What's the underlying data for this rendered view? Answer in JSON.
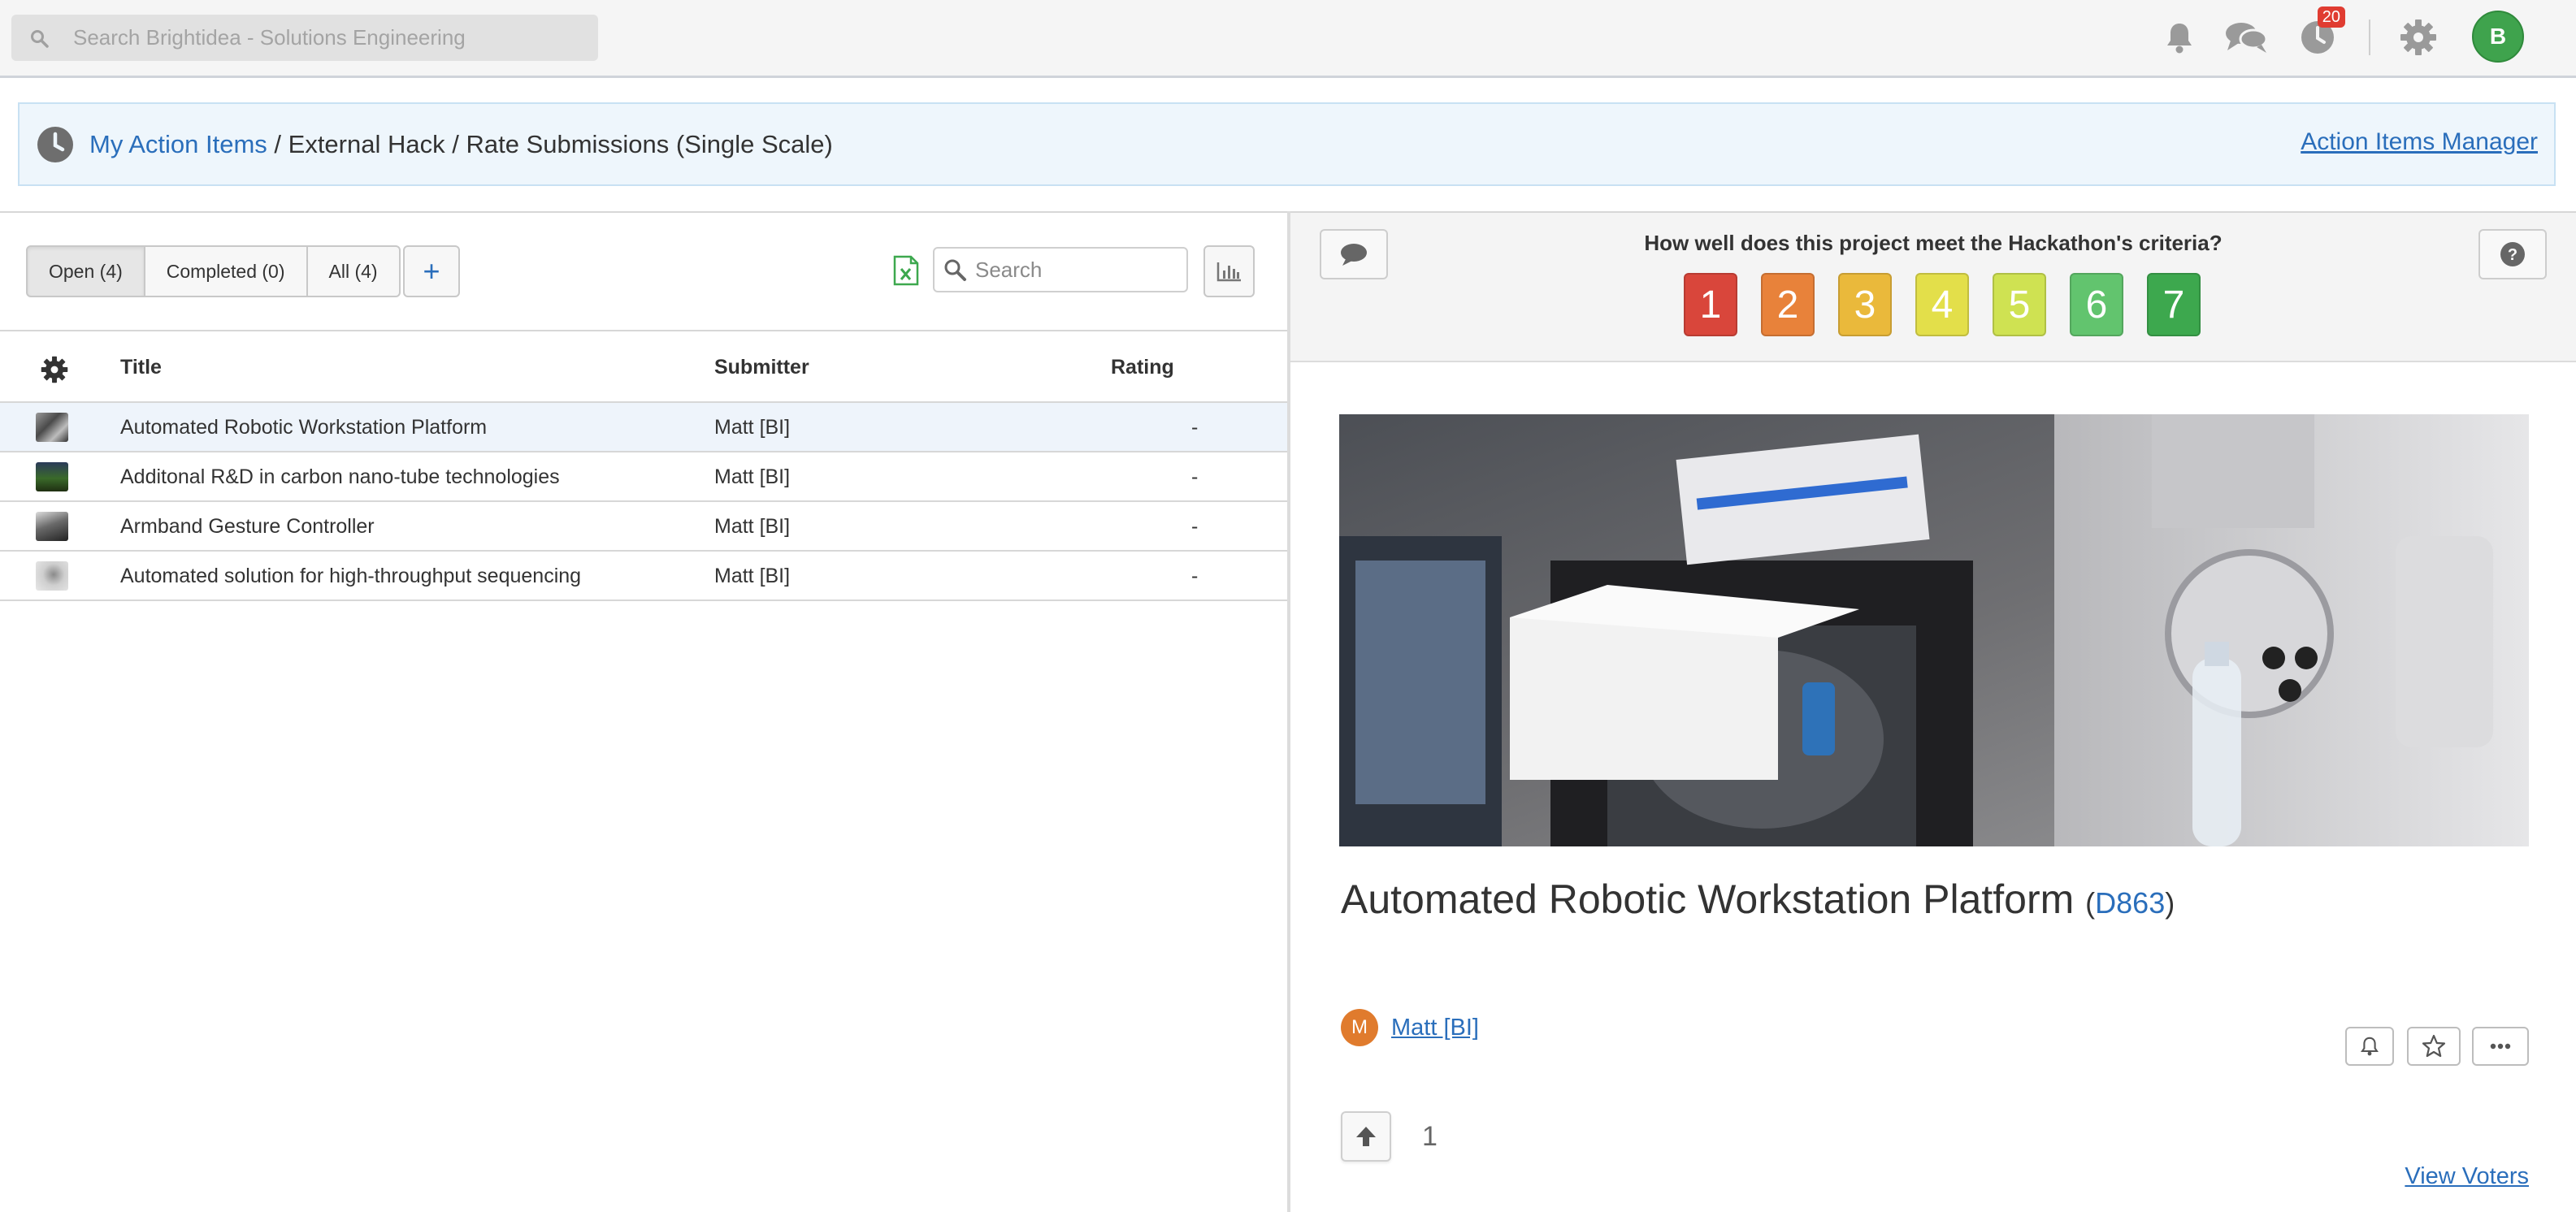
{
  "topbar": {
    "search_placeholder": "Search Brightidea - Solutions Engineering",
    "notifications_badge": "20",
    "user_initial": "B"
  },
  "breadcrumb": {
    "root": "My Action Items",
    "separator": " / ",
    "program": "External Hack",
    "step": "Rate Submissions (Single Scale)",
    "manager_link": "Action Items Manager"
  },
  "list": {
    "tabs": [
      {
        "label": "Open (4)"
      },
      {
        "label": "Completed (0)"
      },
      {
        "label": "All (4)"
      }
    ],
    "add_label": "+",
    "search_placeholder": "Search",
    "columns": {
      "title": "Title",
      "submitter": "Submitter",
      "rating": "Rating"
    },
    "rows": [
      {
        "title": "Automated Robotic Workstation Platform",
        "submitter": "Matt [BI]",
        "rating": "-"
      },
      {
        "title": "Additonal R&D in carbon nano-tube technologies",
        "submitter": "Matt [BI]",
        "rating": "-"
      },
      {
        "title": "Armband Gesture Controller",
        "submitter": "Matt [BI]",
        "rating": "-"
      },
      {
        "title": "Automated solution for high-throughput sequencing",
        "submitter": "Matt [BI]",
        "rating": "-"
      }
    ]
  },
  "rating": {
    "question": "How well does this project meet the Hackathon's criteria?",
    "scale": [
      {
        "label": "1",
        "color": "#d9463b"
      },
      {
        "label": "2",
        "color": "#e8823a"
      },
      {
        "label": "3",
        "color": "#eab93b"
      },
      {
        "label": "4",
        "color": "#e3df4a"
      },
      {
        "label": "5",
        "color": "#cfe252"
      },
      {
        "label": "6",
        "color": "#62c46e"
      },
      {
        "label": "7",
        "color": "#3da84e"
      }
    ]
  },
  "idea": {
    "title": "Automated Robotic Workstation Platform",
    "paren_open": "(",
    "id": "D863",
    "paren_close": ")",
    "submitter_initial": "M",
    "submitter": "Matt [BI]",
    "votes": "1",
    "view_voters": "View Voters"
  },
  "colors": {
    "link": "#2a6ebb",
    "breadcrumb_bg": "#eef6fc",
    "avatar_top": "#3fa34d",
    "submitter_avatar": "#e07b2d",
    "badge": "#e03c31"
  }
}
